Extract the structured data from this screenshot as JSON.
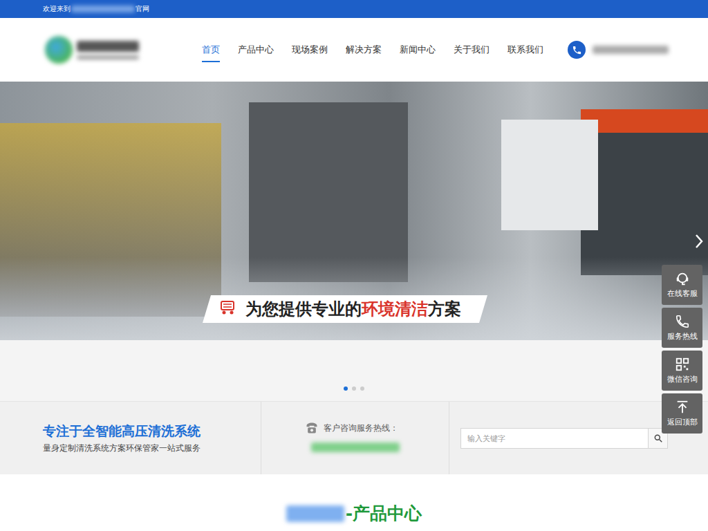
{
  "top_bar": {
    "prefix": "欢迎来到",
    "suffix": "官网"
  },
  "nav": [
    {
      "label": "首页",
      "selected": true
    },
    {
      "label": "产品中心",
      "selected": false
    },
    {
      "label": "现场案例",
      "selected": false
    },
    {
      "label": "解决方案",
      "selected": false
    },
    {
      "label": "新闻中心",
      "selected": false
    },
    {
      "label": "关于我们",
      "selected": false
    },
    {
      "label": "联系我们",
      "selected": false
    }
  ],
  "banner": {
    "caption": [
      {
        "text": "为您提供专业的",
        "highlight": false
      },
      {
        "text": "环境清洁",
        "highlight": true
      },
      {
        "text": "方案",
        "highlight": false
      }
    ],
    "dots": [
      {
        "selected": true
      },
      {
        "selected": false
      },
      {
        "selected": false
      }
    ]
  },
  "slogan": {
    "title": "专注于全智能高压清洗系统",
    "subtitle": "量身定制清洗系统方案环保管家一站式服务"
  },
  "hotline": {
    "label": "客户咨询服务热线："
  },
  "search": {
    "placeholder": "输入关键字"
  },
  "section": {
    "title": "-产品中心"
  },
  "sidebar": [
    {
      "label": "在线客服"
    },
    {
      "label": "服务热线"
    },
    {
      "label": "微信咨询"
    },
    {
      "label": "返回顶部"
    }
  ]
}
